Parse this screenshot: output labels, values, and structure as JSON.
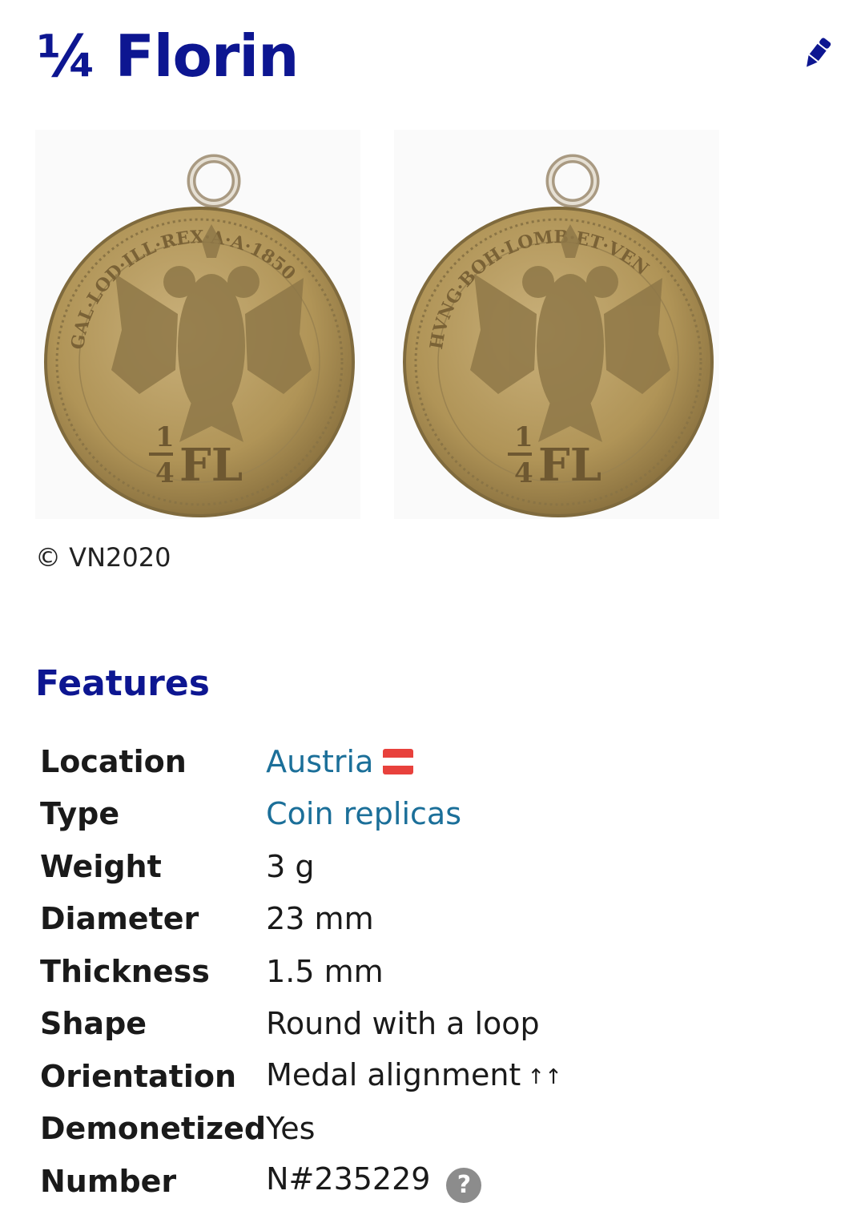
{
  "page": {
    "title": "¼ Florin",
    "edit_icon": "pencil-icon"
  },
  "gallery": {
    "obverse_alt": "obverse",
    "reverse_alt": "reverse",
    "credit": "© VN2020",
    "coin_text": {
      "legend_left": "GAL·LOD·ILL·REX·A·A·1850",
      "legend_right": "HVNG·BOH·LOMB·ET·VEN",
      "fraction_num": "1",
      "fraction_den": "4",
      "denomination": "FL"
    }
  },
  "features": {
    "heading": "Features",
    "rows": [
      {
        "label": "Location",
        "value": "Austria",
        "link": true,
        "flag": "austria-flag-icon"
      },
      {
        "label": "Type",
        "value": "Coin replicas",
        "link": true
      },
      {
        "label": "Weight",
        "value": "3 g"
      },
      {
        "label": "Diameter",
        "value": "23 mm"
      },
      {
        "label": "Thickness",
        "value": "1.5 mm"
      },
      {
        "label": "Shape",
        "value": "Round with a loop"
      },
      {
        "label": "Orientation",
        "value": "Medal alignment",
        "suffix": "↑↑"
      },
      {
        "label": "Demonetized",
        "value": "Yes"
      },
      {
        "label": "Number",
        "value": "N#235229",
        "help": "?"
      }
    ]
  },
  "colors": {
    "heading": "#0d1691",
    "link": "#1b6f99",
    "coin_gold": "#b59a5a",
    "flag_red": "#e8413c"
  }
}
